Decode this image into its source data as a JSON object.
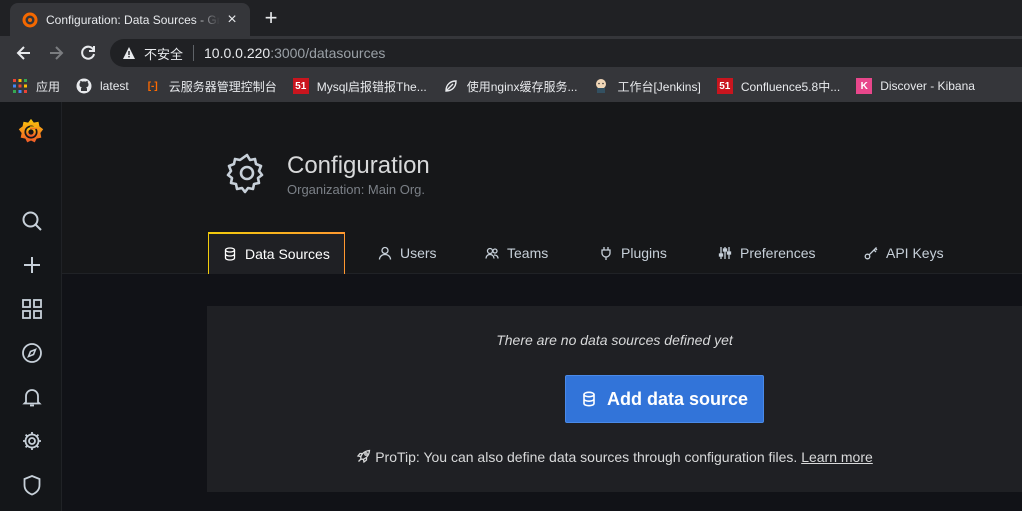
{
  "browser": {
    "tab_title": "Configuration: Data Sources - Grafana",
    "url_security_label": "不安全",
    "url_host": "10.0.0.220",
    "url_path": ":3000/datasources"
  },
  "bookmarks": [
    {
      "label": "应用",
      "icon": "apps-grid-icon"
    },
    {
      "label": "latest",
      "icon": "github-icon"
    },
    {
      "label": "云服务器管理控制台",
      "icon": "aliyun-icon"
    },
    {
      "label": "Mysql启报错报The...",
      "icon": "51cto-icon"
    },
    {
      "label": "使用nginx缓存服务...",
      "icon": "leaf-icon"
    },
    {
      "label": "工作台[Jenkins]",
      "icon": "jenkins-icon"
    },
    {
      "label": "Confluence5.8中...",
      "icon": "51cto-icon"
    },
    {
      "label": "Discover - Kibana",
      "icon": "kibana-icon"
    }
  ],
  "page": {
    "title": "Configuration",
    "subtitle": "Organization: Main Org."
  },
  "tabs": [
    {
      "label": "Data Sources",
      "icon": "database-icon",
      "active": true
    },
    {
      "label": "Users",
      "icon": "user-icon"
    },
    {
      "label": "Teams",
      "icon": "users-icon"
    },
    {
      "label": "Plugins",
      "icon": "plug-icon"
    },
    {
      "label": "Preferences",
      "icon": "sliders-icon"
    },
    {
      "label": "API Keys",
      "icon": "key-icon"
    }
  ],
  "empty_state": {
    "message": "There are no data sources defined yet",
    "button_label": "Add data source",
    "protip": "ProTip: You can also define data sources through configuration files.",
    "learn_more": "Learn more"
  },
  "colors": {
    "accent": "#3274d9",
    "grafana_orange": "#f05a28",
    "background": "#161719"
  }
}
